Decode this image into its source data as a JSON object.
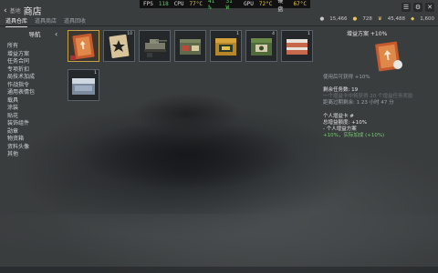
{
  "fps_bar": {
    "fps_label": "FPS",
    "fps_value": "118",
    "cpu_label": "CPU",
    "cpu_temp": "77°C",
    "cpu_usage": "41 %",
    "power": "31 W",
    "gpu_label": "GPU",
    "gpu_temp": "72°C",
    "disk_label": "硬盘",
    "disk_temp": "67°C"
  },
  "header": {
    "back_small": "基地",
    "title": "商店"
  },
  "tabs": [
    {
      "label": "道具仓库",
      "active": true
    },
    {
      "label": "道具商店",
      "active": false
    },
    {
      "label": "道具回收",
      "active": false
    }
  ],
  "currency": {
    "lions": "15,466",
    "eagles": "728",
    "premium": "45,488",
    "wallet": "1,600"
  },
  "sidebar": {
    "title": "导航",
    "items": [
      "所有",
      "增益方案",
      "任务合同",
      "专项折扣",
      "局技术加成",
      "作战指令",
      "通用表情包",
      "载具",
      "涂装",
      "贴花",
      "装饰组件",
      "勋章",
      "物资箱",
      "资料头像",
      "其他"
    ]
  },
  "grid": {
    "items": [
      {
        "name": "booster-card",
        "count": "",
        "selected": true
      },
      {
        "name": "star-card",
        "count": "10",
        "selected": false
      },
      {
        "name": "vehicle-crate",
        "count": "",
        "selected": false
      },
      {
        "name": "military-crate",
        "count": "",
        "selected": false
      },
      {
        "name": "yellow-crate",
        "count": "1",
        "selected": false
      },
      {
        "name": "green-crate",
        "count": "4",
        "selected": false
      },
      {
        "name": "winter-crate",
        "count": "1",
        "selected": false
      },
      {
        "name": "north-wave-crate",
        "count": "1",
        "selected": false
      }
    ]
  },
  "details": {
    "title": "增益方案 +10%",
    "line1": "使用后可获得 +10%",
    "line2": "剩余任务数: 19",
    "line3": "一个增益卡中将获得 20 个增益任务奖励",
    "line4": "距离过期剩余: 1 23 小时 47 分",
    "line5": "个人增益卡 #",
    "line6": "总增益额度: +10%",
    "line7": "- 个人增益方案",
    "line8": "+10%，实际加成 (+10%)"
  },
  "colors": {
    "selected_border": "#c9a04a",
    "accent_green": "#7cc878"
  }
}
